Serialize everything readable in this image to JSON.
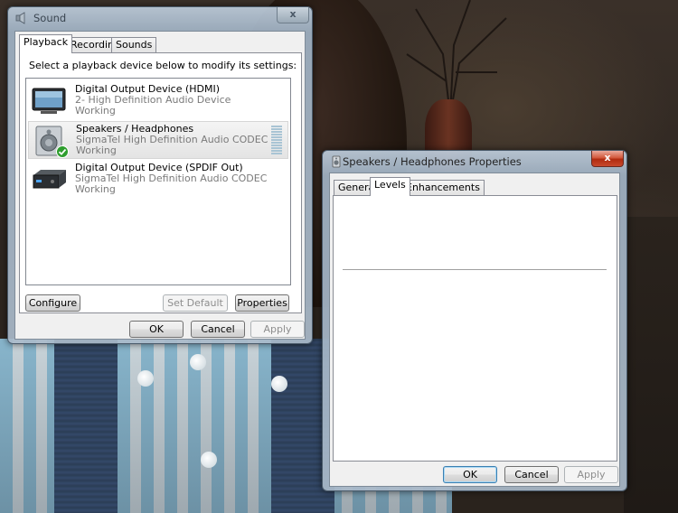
{
  "sound_window": {
    "title": "Sound",
    "close_label": "x",
    "tabs": [
      {
        "label": "Playback",
        "selected": true
      },
      {
        "label": "Recording",
        "selected": false
      },
      {
        "label": "Sounds",
        "selected": false
      }
    ],
    "instruction": "Select a playback device below to modify its settings:",
    "devices": [
      {
        "name": "Digital Output Device (HDMI)",
        "driver": "2- High Definition Audio Device",
        "status": "Working",
        "icon": "monitor-icon",
        "selected": false
      },
      {
        "name": "Speakers / Headphones",
        "driver": "SigmaTel High Definition Audio CODEC",
        "status": "Working",
        "icon": "speaker-icon",
        "selected": true,
        "is_default": true
      },
      {
        "name": "Digital Output Device (SPDIF Out)",
        "driver": "SigmaTel High Definition Audio CODEC",
        "status": "Working",
        "icon": "digital-output-box-icon",
        "selected": false
      }
    ],
    "buttons": {
      "configure": "Configure",
      "set_default": "Set Default",
      "properties": "Properties",
      "ok": "OK",
      "cancel": "Cancel",
      "apply": "Apply"
    }
  },
  "properties_window": {
    "title": "Speakers / Headphones Properties",
    "close_label": "x",
    "tabs": [
      {
        "label": "General",
        "selected": false
      },
      {
        "label": "Levels",
        "selected": true
      },
      {
        "label": "Enhancements",
        "selected": false
      }
    ],
    "buttons": {
      "ok": "OK",
      "cancel": "Cancel",
      "apply": "Apply"
    }
  },
  "colors": {
    "selection_bg": "#e8e8e8",
    "default_check": "#2e9e2e",
    "close_red": "#c8482c"
  }
}
